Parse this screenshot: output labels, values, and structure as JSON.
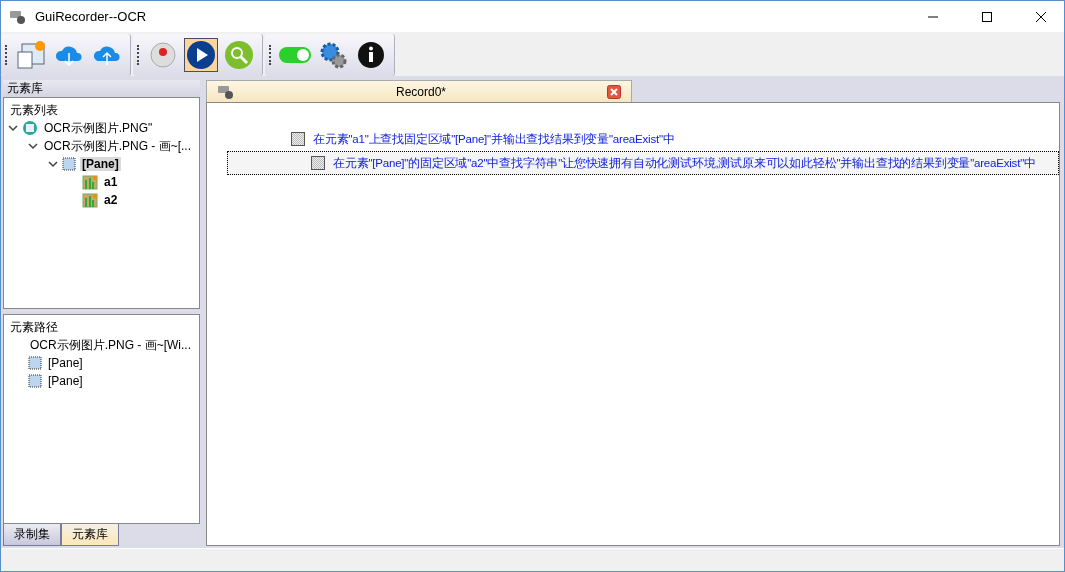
{
  "window": {
    "title": "GuiRecorder--OCR"
  },
  "toolbar": {
    "switch_on": true,
    "play_selected": true
  },
  "left_panel": {
    "title": "元素库",
    "element_list": {
      "title": "元素列表",
      "tree": [
        {
          "label": "OCR示例图片.PNG\"",
          "kind": "app",
          "expanded": true,
          "selected": false,
          "children": [
            {
              "label": "OCR示例图片.PNG - 画~[...",
              "expanded": true,
              "selected": false,
              "children": [
                {
                  "label": "[Pane]",
                  "kind": "pane",
                  "expanded": true,
                  "selected": true,
                  "children": [
                    {
                      "label": "a1",
                      "kind": "image",
                      "selected": false
                    },
                    {
                      "label": "a2",
                      "kind": "image",
                      "selected": false
                    }
                  ]
                }
              ]
            }
          ]
        }
      ]
    },
    "element_path": {
      "title": "元素路径",
      "items": [
        {
          "label": "OCR示例图片.PNG - 画~[Wi..."
        },
        {
          "label": "[Pane]",
          "kind": "pane"
        },
        {
          "label": "[Pane]",
          "kind": "pane"
        }
      ]
    },
    "tabs": [
      {
        "label": "录制集",
        "selected": false
      },
      {
        "label": "元素库",
        "selected": true
      }
    ]
  },
  "document": {
    "tab": {
      "title": "Record0*"
    },
    "steps": [
      {
        "text": "在元素\"a1\"上查找固定区域\"[Pane]\"并输出查找结果到变量\"areaExist\"中",
        "checked": false,
        "selected": false
      },
      {
        "text": "在元素\"[Pane]\"的固定区域\"a2\"中查找字符串\"让您快速拥有自动化测试环境,测试原来可以如此轻松\"并输出查找的结果到变量\"areaExist\"中",
        "checked": false,
        "selected": true
      }
    ]
  }
}
